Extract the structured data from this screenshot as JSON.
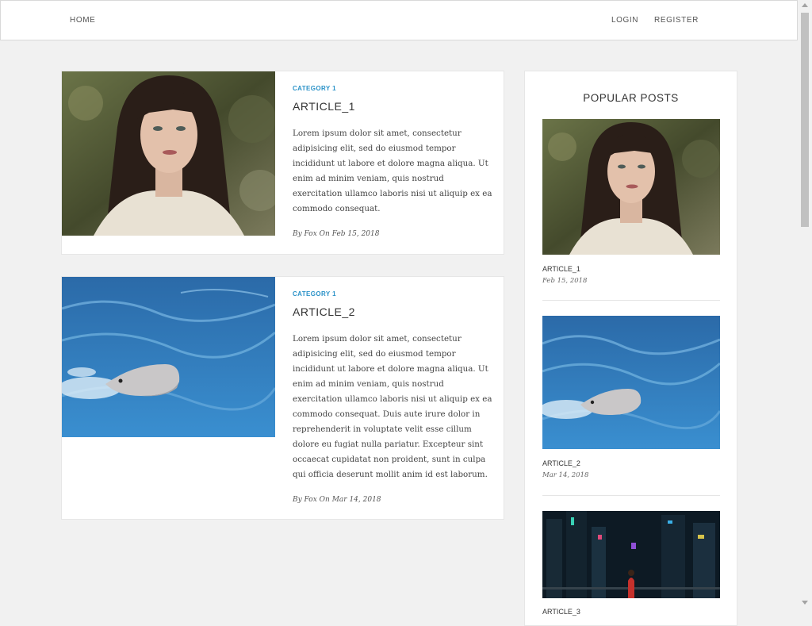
{
  "nav": {
    "home": "HOME",
    "login": "LOGIN",
    "register": "REGISTER"
  },
  "articles": [
    {
      "category": "CATEGORY 1",
      "title": "ARTICLE_1",
      "excerpt": "Lorem ipsum dolor sit amet, consectetur adipisicing elit, sed do eiusmod tempor incididunt ut labore et dolore magna aliqua. Ut enim ad minim veniam, quis nostrud exercitation ullamco laboris nisi ut aliquip ex ea commodo consequat.",
      "byline": "By Fox On Feb 15, 2018",
      "image": "portrait-photo"
    },
    {
      "category": "CATEGORY 1",
      "title": "ARTICLE_2",
      "excerpt": "Lorem ipsum dolor sit amet, consectetur adipisicing elit, sed do eiusmod tempor incididunt ut labore et dolore magna aliqua. Ut enim ad minim veniam, quis nostrud exercitation ullamco laboris nisi ut aliquip ex ea commodo consequat. Duis aute irure dolor in reprehenderit in voluptate velit esse cillum dolore eu fugiat nulla pariatur. Excepteur sint occaecat cupidatat non proident, sunt in culpa qui officia deserunt mollit anim id est laborum.",
      "byline": "By Fox On Mar 14, 2018",
      "image": "dolphin-photo"
    }
  ],
  "sidebar": {
    "title": "POPULAR POSTS",
    "posts": [
      {
        "title": "ARTICLE_1",
        "date": "Feb 15, 2018",
        "image": "portrait-photo"
      },
      {
        "title": "ARTICLE_2",
        "date": "Mar 14, 2018",
        "image": "dolphin-photo"
      },
      {
        "title": "ARTICLE_3",
        "image": "city-night-photo"
      }
    ]
  },
  "colors": {
    "accent": "#2a92c8",
    "background": "#f1f1f1"
  }
}
